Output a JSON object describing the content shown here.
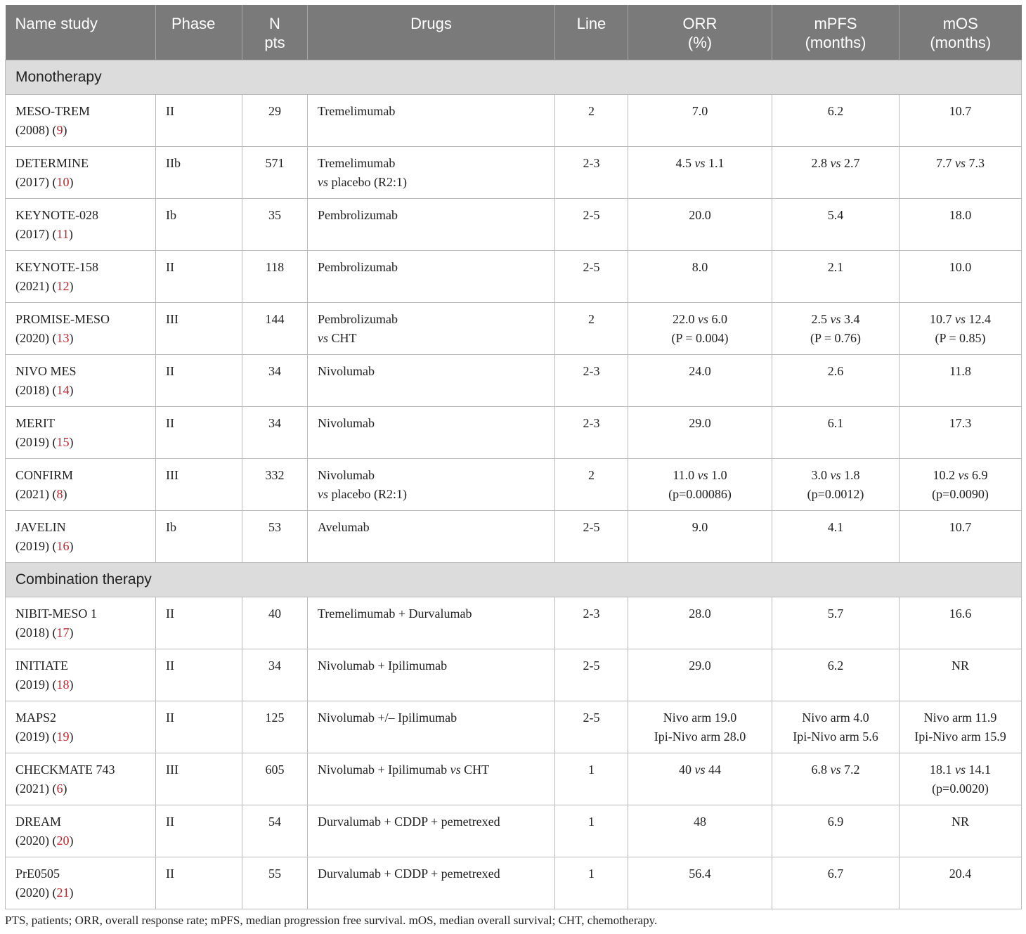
{
  "headers": [
    {
      "lines": [
        "Name study"
      ]
    },
    {
      "lines": [
        "Phase"
      ]
    },
    {
      "lines": [
        "N",
        "pts"
      ]
    },
    {
      "lines": [
        "Drugs"
      ]
    },
    {
      "lines": [
        "Line"
      ]
    },
    {
      "lines": [
        "ORR",
        "(%)"
      ]
    },
    {
      "lines": [
        "mPFS",
        "(months)"
      ]
    },
    {
      "lines": [
        "mOS",
        "(months)"
      ]
    }
  ],
  "sections": [
    {
      "title": "Monotherapy",
      "rows": [
        {
          "name": "MESO-TREM",
          "year": "(2008)",
          "ref": "9",
          "phase": "II",
          "n": "29",
          "drugs": [
            "Tremelimumab"
          ],
          "line": "2",
          "orr": [
            "7.0"
          ],
          "mpfs": [
            "6.2"
          ],
          "mos": [
            "10.7"
          ]
        },
        {
          "name": "DETERMINE",
          "year": "(2017)",
          "ref": "10",
          "phase": "IIb",
          "n": "571",
          "drugs": [
            "Tremelimumab",
            "vs placebo (R2:1)"
          ],
          "line": "2-3",
          "orr": [
            "4.5 vs 1.1"
          ],
          "mpfs": [
            "2.8 vs 2.7"
          ],
          "mos": [
            "7.7 vs 7.3"
          ]
        },
        {
          "name": "KEYNOTE-028",
          "year": "(2017)",
          "ref": "11",
          "phase": "Ib",
          "n": "35",
          "drugs": [
            "Pembrolizumab"
          ],
          "line": "2-5",
          "orr": [
            "20.0"
          ],
          "mpfs": [
            "5.4"
          ],
          "mos": [
            "18.0"
          ]
        },
        {
          "name": "KEYNOTE-158",
          "year": "(2021)",
          "ref": "12",
          "phase": "II",
          "n": "118",
          "drugs": [
            "Pembrolizumab"
          ],
          "line": "2-5",
          "orr": [
            "8.0"
          ],
          "mpfs": [
            "2.1"
          ],
          "mos": [
            "10.0"
          ]
        },
        {
          "name": "PROMISE-MESO",
          "year": "(2020)",
          "ref": "13",
          "phase": "III",
          "n": "144",
          "drugs": [
            "Pembrolizumab",
            "vs CHT"
          ],
          "line": "2",
          "orr": [
            "22.0 vs 6.0",
            "(P = 0.004)"
          ],
          "mpfs": [
            "2.5 vs 3.4",
            "(P = 0.76)"
          ],
          "mos": [
            "10.7 vs 12.4",
            "(P = 0.85)"
          ]
        },
        {
          "name": "NIVO MES",
          "year": "(2018)",
          "ref": "14",
          "phase": "II",
          "n": "34",
          "drugs": [
            "Nivolumab"
          ],
          "line": "2-3",
          "orr": [
            "24.0"
          ],
          "mpfs": [
            "2.6"
          ],
          "mos": [
            "11.8"
          ]
        },
        {
          "name": "MERIT",
          "year": "(2019)",
          "ref": "15",
          "phase": "II",
          "n": "34",
          "drugs": [
            "Nivolumab"
          ],
          "line": "2-3",
          "orr": [
            "29.0"
          ],
          "mpfs": [
            "6.1"
          ],
          "mos": [
            "17.3"
          ]
        },
        {
          "name": "CONFIRM",
          "year": "(2021)",
          "ref": "8",
          "phase": "III",
          "n": "332",
          "drugs": [
            "Nivolumab",
            "vs placebo (R2:1)"
          ],
          "line": "2",
          "orr": [
            "11.0 vs 1.0",
            "(p=0.00086)"
          ],
          "mpfs": [
            "3.0 vs 1.8",
            "(p=0.0012)"
          ],
          "mos": [
            "10.2 vs 6.9",
            "(p=0.0090)"
          ]
        },
        {
          "name": "JAVELIN",
          "year": "(2019)",
          "ref": "16",
          "phase": "Ib",
          "n": "53",
          "drugs": [
            "Avelumab"
          ],
          "line": "2-5",
          "orr": [
            "9.0"
          ],
          "mpfs": [
            "4.1"
          ],
          "mos": [
            "10.7"
          ]
        }
      ]
    },
    {
      "title": "Combination therapy",
      "rows": [
        {
          "name": "NIBIT-MESO 1",
          "year": "(2018)",
          "ref": "17",
          "phase": "II",
          "n": "40",
          "drugs": [
            "Tremelimumab + Durvalumab"
          ],
          "line": "2-3",
          "orr": [
            "28.0"
          ],
          "mpfs": [
            "5.7"
          ],
          "mos": [
            "16.6"
          ]
        },
        {
          "name": "INITIATE",
          "year": "(2019)",
          "ref": "18",
          "phase": "II",
          "n": "34",
          "drugs": [
            "Nivolumab + Ipilimumab"
          ],
          "line": "2-5",
          "orr": [
            "29.0"
          ],
          "mpfs": [
            "6.2"
          ],
          "mos": [
            "NR"
          ]
        },
        {
          "name": "MAPS2",
          "year": "(2019)",
          "ref": "19",
          "phase": "II",
          "n": "125",
          "drugs": [
            "Nivolumab +/– Ipilimumab"
          ],
          "line": "2-5",
          "orr": [
            "Nivo arm 19.0",
            "Ipi-Nivo arm 28.0"
          ],
          "mpfs": [
            "Nivo arm 4.0",
            "Ipi-Nivo arm 5.6"
          ],
          "mos": [
            "Nivo arm 11.9",
            "Ipi-Nivo arm 15.9"
          ]
        },
        {
          "name": "CHECKMATE 743",
          "year": "(2021)",
          "ref": "6",
          "phase": "III",
          "n": "605",
          "drugs": [
            "Nivolumab + Ipilimumab vs CHT"
          ],
          "line": "1",
          "orr": [
            "40 vs 44"
          ],
          "mpfs": [
            "6.8 vs 7.2"
          ],
          "mos": [
            "18.1 vs 14.1",
            "(p=0.0020)"
          ]
        },
        {
          "name": "DREAM",
          "year": "(2020)",
          "ref": "20",
          "phase": "II",
          "n": "54",
          "drugs": [
            "Durvalumab + CDDP + pemetrexed"
          ],
          "line": "1",
          "orr": [
            "48"
          ],
          "mpfs": [
            "6.9"
          ],
          "mos": [
            "NR"
          ]
        },
        {
          "name": "PrE0505",
          "year": "(2020)",
          "ref": "21",
          "phase": "II",
          "n": "55",
          "drugs": [
            "Durvalumab + CDDP + pemetrexed"
          ],
          "line": "1",
          "orr": [
            "56.4"
          ],
          "mpfs": [
            "6.7"
          ],
          "mos": [
            "20.4"
          ]
        }
      ]
    }
  ],
  "footnote": "PTS, patients; ORR, overall response rate; mPFS, median progression free survival. mOS, median overall survival; CHT, chemotherapy.",
  "colors": {
    "header_bg": "#7a7a7a",
    "section_bg": "#dcdcdc",
    "ref_red": "#c0262d",
    "border": "#b9b9b9"
  }
}
